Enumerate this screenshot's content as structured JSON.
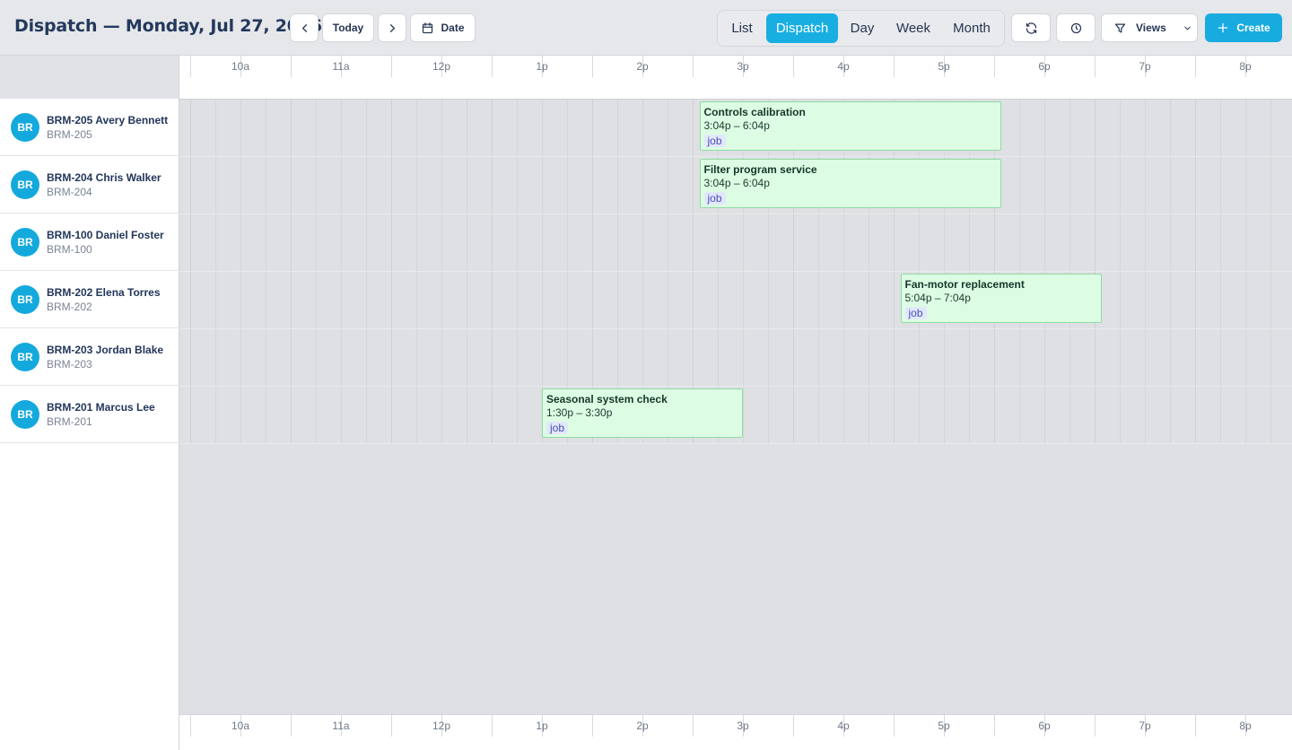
{
  "header": {
    "title": "Dispatch — Monday, Jul 27, 2026",
    "today_label": "Today",
    "date_label": "Date",
    "views_label": "Views",
    "create_label": "Create"
  },
  "view_tabs": [
    "List",
    "Dispatch",
    "Day",
    "Week",
    "Month"
  ],
  "active_view": "Dispatch",
  "hours": [
    "10a",
    "11a",
    "12p",
    "1p",
    "2p",
    "3p",
    "4p",
    "5p",
    "6p",
    "7p",
    "8p"
  ],
  "technicians": [
    {
      "initials": "BR",
      "name": "BRM-205 Avery Bennett",
      "code": "BRM-205"
    },
    {
      "initials": "BR",
      "name": "BRM-204 Chris Walker",
      "code": "BRM-204"
    },
    {
      "initials": "BR",
      "name": "BRM-100 Daniel Foster",
      "code": "BRM-100"
    },
    {
      "initials": "BR",
      "name": "BRM-202 Elena Torres",
      "code": "BRM-202"
    },
    {
      "initials": "BR",
      "name": "BRM-203 Jordan Blake",
      "code": "BRM-203"
    },
    {
      "initials": "BR",
      "name": "BRM-201 Marcus Lee",
      "code": "BRM-201"
    }
  ],
  "events": [
    {
      "title": "Controls calibration",
      "time": "3:04p – 6:04p",
      "tag": "job",
      "technician": "BRM-205 Avery Bennett",
      "start_hour": 15.067,
      "end_hour": 18.067
    },
    {
      "title": "Filter program service",
      "time": "3:04p – 6:04p",
      "tag": "job",
      "technician": "BRM-204 Chris Walker",
      "start_hour": 15.067,
      "end_hour": 18.067
    },
    {
      "title": "Fan-motor replacement",
      "time": "5:04p – 7:04p",
      "tag": "job",
      "technician": "BRM-202 Elena Torres",
      "start_hour": 17.067,
      "end_hour": 19.067
    },
    {
      "title": "Seasonal system check",
      "time": "1:30p – 3:30p",
      "tag": "job",
      "technician": "BRM-201 Marcus Lee",
      "start_hour": 13.5,
      "end_hour": 15.5
    }
  ],
  "colors": {
    "accent": "#19aee1",
    "event_bg": "#dcfce4",
    "event_border": "#8fdba4",
    "tag_text": "#4a4fb6"
  }
}
